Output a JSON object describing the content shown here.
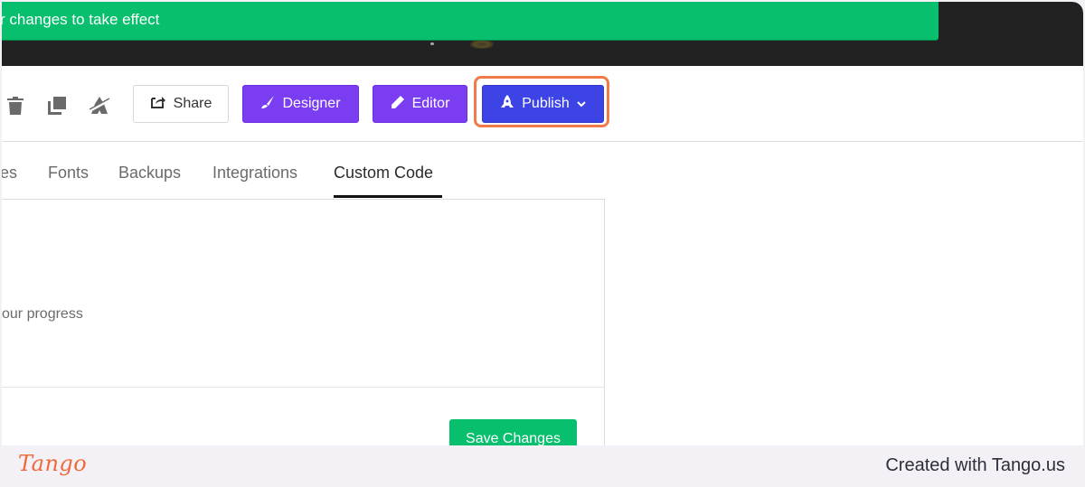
{
  "notification": {
    "text": "r changes to take effect",
    "color": "#07bf6d"
  },
  "toolbar": {
    "icons": [
      "trash-icon",
      "duplicate-icon",
      "unpublish-icon"
    ],
    "share_label": "Share",
    "designer_label": "Designer",
    "editor_label": "Editor",
    "publish_label": "Publish",
    "accent_purple": "#7b3df2",
    "accent_blue": "#3d44e6",
    "highlight_color": "#f07a4a"
  },
  "tabs": [
    {
      "label": "es",
      "active": false
    },
    {
      "label": "Fonts",
      "active": false
    },
    {
      "label": "Backups",
      "active": false
    },
    {
      "label": "Integrations",
      "active": false
    },
    {
      "label": "Custom Code",
      "active": true
    }
  ],
  "panel": {
    "text": "our progress",
    "save_label": "Save Changes"
  },
  "footer": {
    "logo": "Tango",
    "credit": "Created with Tango.us"
  }
}
